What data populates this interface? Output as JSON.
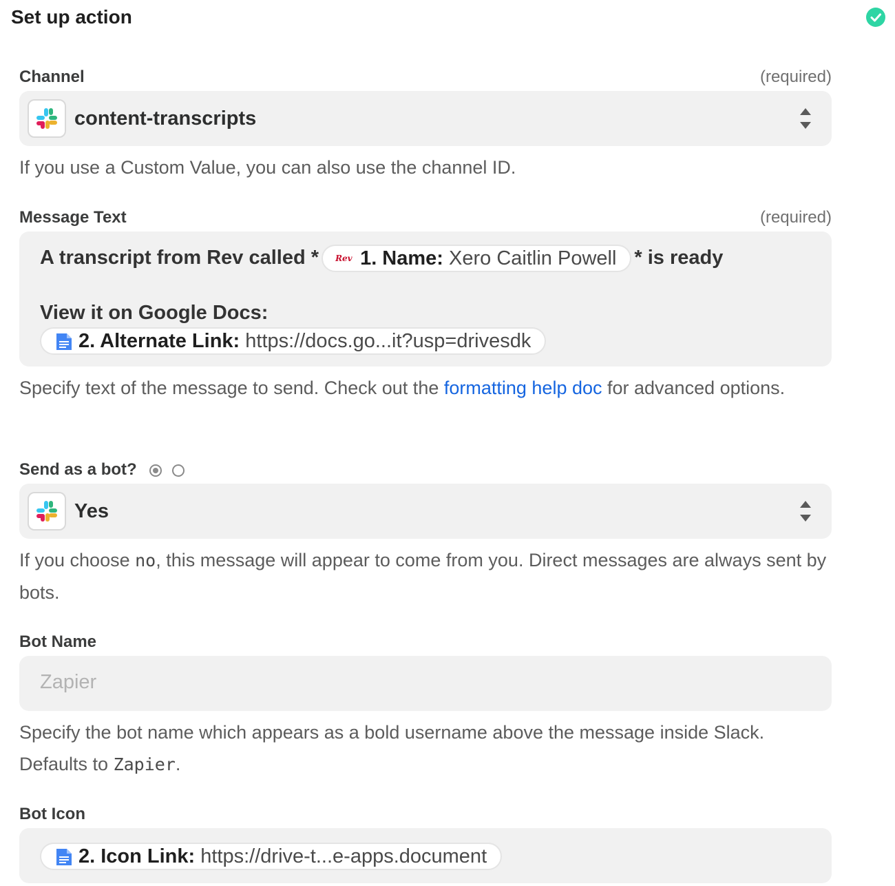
{
  "header": {
    "title": "Set up action"
  },
  "channel": {
    "label": "Channel",
    "required": "(required)",
    "value": "content-transcripts",
    "help": "If you use a Custom Value, you can also use the channel ID."
  },
  "message": {
    "label": "Message Text",
    "required": "(required)",
    "line1_prefix": "A transcript from Rev called *",
    "line1_suffix": "* is ready",
    "pill1_key": "1. Name:",
    "pill1_value": "Xero Caitlin Powell",
    "rev_logo": "Rev",
    "line2": "View it on Google Docs:",
    "pill2_key": "2. Alternate Link:",
    "pill2_value": "https://docs.go...it?usp=drivesdk",
    "help_before": "Specify text of the message to send. Check out the ",
    "help_link": "formatting help doc",
    "help_after": " for advanced options."
  },
  "bot": {
    "label": "Send as a bot?",
    "value": "Yes",
    "help_before": "If you choose ",
    "help_code": "no",
    "help_after": ", this message will appear to come from you. Direct messages are always sent by bots."
  },
  "bot_name": {
    "label": "Bot Name",
    "placeholder": "Zapier",
    "help_before": "Specify the bot name which appears as a bold username above the message inside Slack. Defaults to ",
    "help_code": "Zapier",
    "help_after": "."
  },
  "bot_icon": {
    "label": "Bot Icon",
    "pill_key": "2. Icon Link:",
    "pill_value": "https://drive-t...e-apps.document"
  },
  "icons": {
    "status": "check-circle-icon",
    "app": "slack-icon",
    "dropdown": "sort-arrows-icon",
    "doc": "google-docs-icon",
    "rev": "rev-icon"
  },
  "colors": {
    "success": "#2ed5a4",
    "link": "#1565e0",
    "field_bg": "#f1f1f1",
    "rev_red": "#c8102e",
    "docs_blue": "#4285f4"
  }
}
